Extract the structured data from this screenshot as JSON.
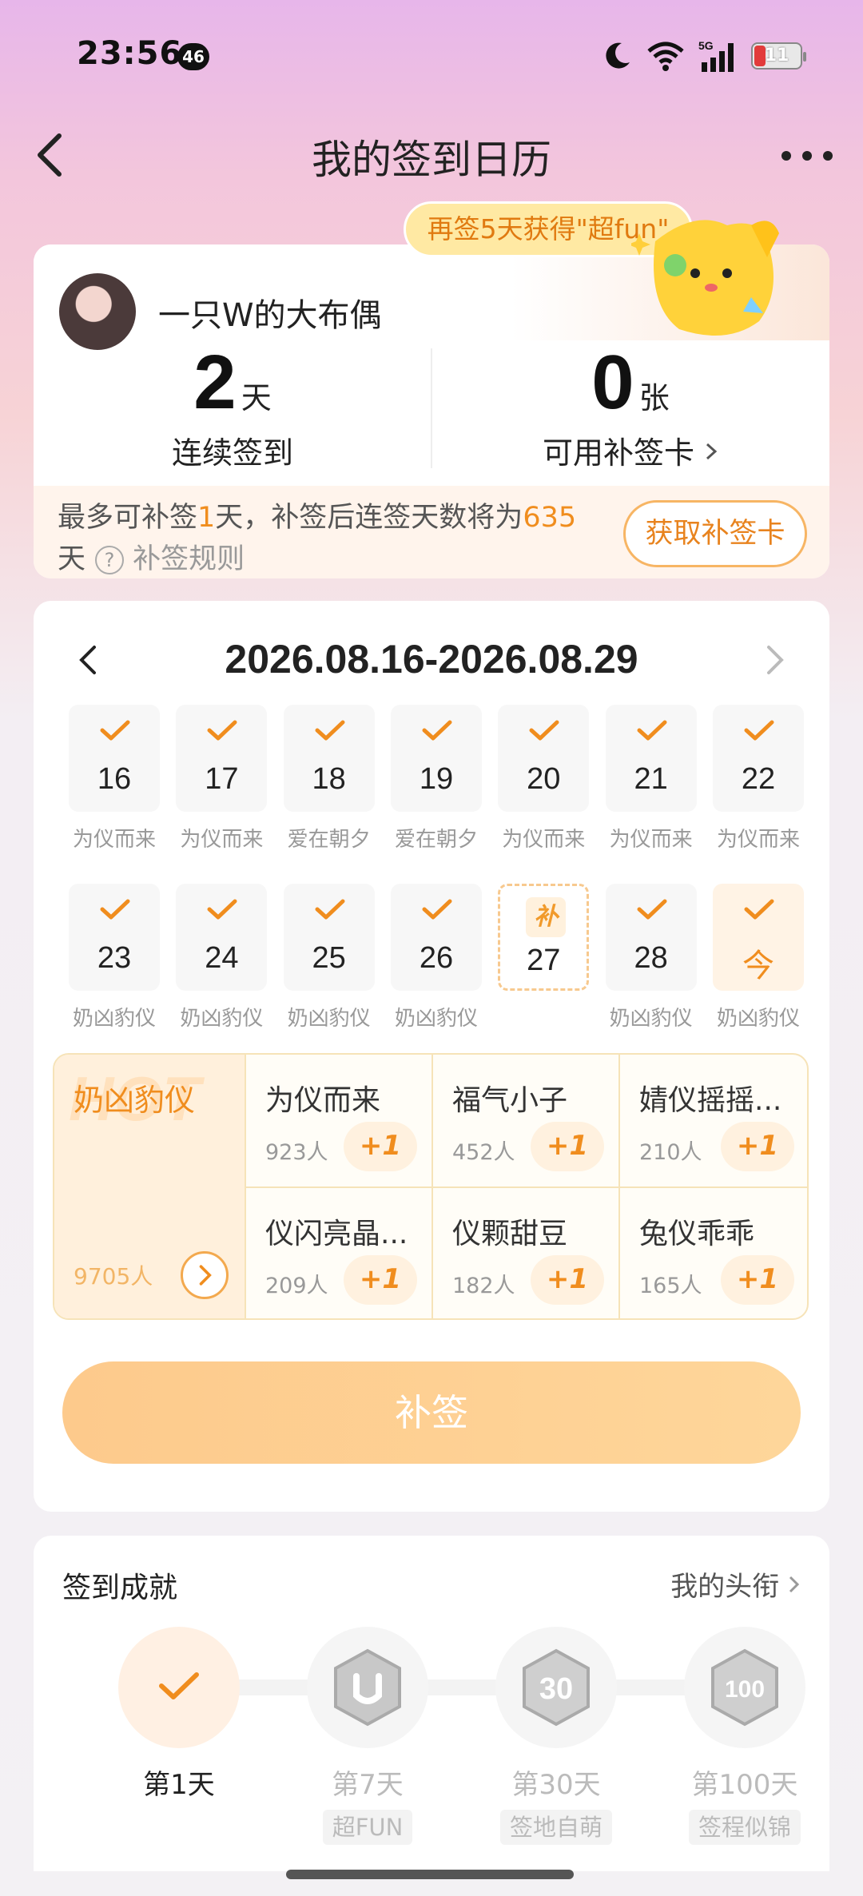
{
  "status": {
    "time": "23:56",
    "net_badge": "46",
    "battery": "11",
    "signal": "5G"
  },
  "nav": {
    "title": "我的签到日历"
  },
  "promo": "再签5天获得\"超fun\"",
  "user": {
    "name": "一只W的大布偶"
  },
  "stats": {
    "streak_value": "2",
    "streak_unit": "天",
    "streak_label": "连续签到",
    "cards_value": "0",
    "cards_unit": "张",
    "cards_label": "可用补签卡"
  },
  "makeup": {
    "pre": "最多可补签",
    "days": "1",
    "mid": "天，补签后连签天数将为",
    "total": "635",
    "post": "天",
    "rule": "补签规则",
    "button": "获取补签卡"
  },
  "calendar": {
    "range": "2026.08.16-2026.08.29",
    "week1": [
      {
        "d": "16",
        "label": "为仪而来"
      },
      {
        "d": "17",
        "label": "为仪而来"
      },
      {
        "d": "18",
        "label": "爱在朝夕"
      },
      {
        "d": "19",
        "label": "爱在朝夕"
      },
      {
        "d": "20",
        "label": "为仪而来"
      },
      {
        "d": "21",
        "label": "为仪而来"
      },
      {
        "d": "22",
        "label": "为仪而来"
      }
    ],
    "week2": [
      {
        "d": "23",
        "label": "奶凶豹仪"
      },
      {
        "d": "24",
        "label": "奶凶豹仪"
      },
      {
        "d": "25",
        "label": "奶凶豹仪"
      },
      {
        "d": "26",
        "label": "奶凶豹仪"
      },
      {
        "d": "27",
        "label": "",
        "mark": "补"
      },
      {
        "d": "28",
        "label": "奶凶豹仪"
      },
      {
        "d": "今",
        "label": "奶凶豹仪"
      }
    ]
  },
  "topics": {
    "featured": {
      "hot": "HOT",
      "name": "奶凶豹仪",
      "count": "9705人"
    },
    "items": [
      {
        "name": "为仪而来",
        "count": "923人",
        "plus": "+1"
      },
      {
        "name": "福气小子",
        "count": "452人",
        "plus": "+1"
      },
      {
        "name": "婧仪摇摇...",
        "count": "210人",
        "plus": "+1"
      },
      {
        "name": "仪闪亮晶...",
        "count": "209人",
        "plus": "+1"
      },
      {
        "name": "仪颗甜豆",
        "count": "182人",
        "plus": "+1"
      },
      {
        "name": "兔仪乖乖",
        "count": "165人",
        "plus": "+1"
      }
    ]
  },
  "main_button": "补签",
  "achievements": {
    "title": "签到成就",
    "link": "我的头衔",
    "items": [
      {
        "day": "第1天",
        "tag": ""
      },
      {
        "day": "第7天",
        "tag": "超FUN"
      },
      {
        "day": "第30天",
        "tag": "签地自萌"
      },
      {
        "day": "第100天",
        "tag": "签程似锦"
      }
    ]
  },
  "colors": {
    "accent": "#f08d1e",
    "button": "#fdca8c"
  }
}
